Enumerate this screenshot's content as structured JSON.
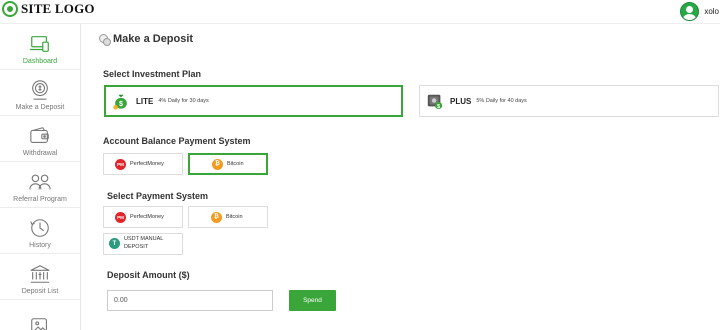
{
  "header": {
    "logo_text": "SITE LOGO",
    "username": "xolo"
  },
  "sidebar": {
    "items": [
      {
        "label": "Dashboard",
        "icon": "monitor-icon",
        "active": true
      },
      {
        "label": "Make a Deposit",
        "icon": "coin-icon",
        "active": false
      },
      {
        "label": "Withdrawal",
        "icon": "wallet-icon",
        "active": false
      },
      {
        "label": "Referral Program",
        "icon": "users-icon",
        "active": false
      },
      {
        "label": "History",
        "icon": "clock-icon",
        "active": false
      },
      {
        "label": "Deposit List",
        "icon": "bank-icon",
        "active": false
      },
      {
        "label": "",
        "icon": "image-icon",
        "active": false
      }
    ]
  },
  "main": {
    "title": "Make a Deposit",
    "investment": {
      "label": "Select Investment Plan",
      "plans": [
        {
          "name": "LITE",
          "desc": "4% Daily for 30 days",
          "selected": true
        },
        {
          "name": "PLUS",
          "desc": "5% Daily for 40 days",
          "selected": false
        }
      ]
    },
    "balance_system": {
      "label": "Account Balance Payment System",
      "options": [
        {
          "label": "PerfectMoney",
          "selected": false
        },
        {
          "label": "Bitcoin",
          "selected": true
        }
      ]
    },
    "payment_system": {
      "label": "Select Payment System",
      "options": [
        {
          "label": "PerfectMoney"
        },
        {
          "label": "Bitcoin"
        },
        {
          "label": "USDT MANUAL DEPOSIT"
        }
      ]
    },
    "amount": {
      "label": "Deposit Amount ($)",
      "value": "0.00",
      "button": "Spend"
    }
  },
  "colors": {
    "accent": "#3aa63a",
    "perfectmoney": "#e0262a",
    "bitcoin": "#f39a1f",
    "usdt": "#2a9d7f"
  }
}
